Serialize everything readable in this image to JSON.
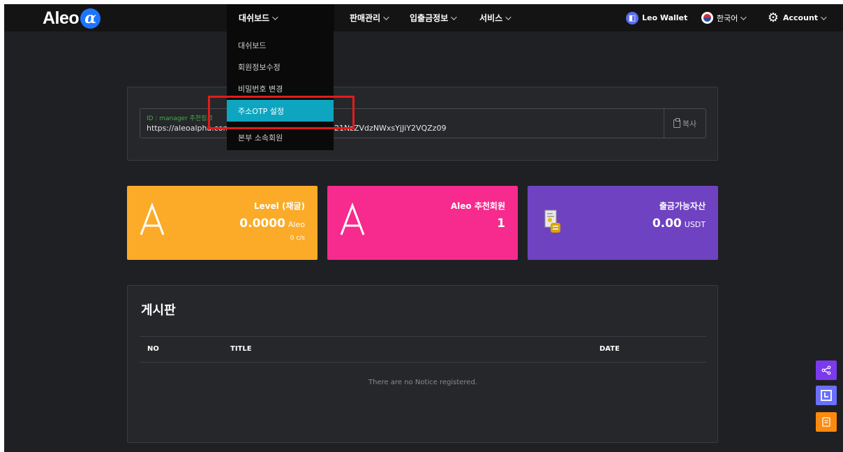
{
  "header": {
    "logo_text": "Aleo",
    "logo_symbol": "α",
    "nav": [
      {
        "label": "대쉬보드",
        "active": true
      },
      {
        "label": "판매관리",
        "active": false
      },
      {
        "label": "입출금정보",
        "active": false
      },
      {
        "label": "서비스",
        "active": false
      }
    ],
    "wallet_label": "Leo Wallet",
    "language_label": "한국어",
    "account_label": "Account"
  },
  "dropdown": {
    "items": [
      {
        "label": "대쉬보드",
        "active": false
      },
      {
        "label": "회원정보수정",
        "active": false
      },
      {
        "label": "비밀번호 변경",
        "active": false
      },
      {
        "label": "주소OTP 설정",
        "active": true
      },
      {
        "label": "본부 소속회원",
        "active": false
      }
    ]
  },
  "referral": {
    "label": "ID : manager 추천링크",
    "url_start": "https://aleoalpha.com",
    "url_end": "21NzZVdzNWxsYjJiY2VQZz09",
    "copy_label": "복사"
  },
  "stats": [
    {
      "title": "Level (채굴)",
      "value": "0.0000",
      "unit": "Aleo",
      "sub": "0 c/s",
      "color": "#fbab28"
    },
    {
      "title": "Aleo 추천회원",
      "value": "1",
      "unit": "",
      "sub": "",
      "color": "#f72a8e"
    },
    {
      "title": "출금가능자산",
      "value": "0.00",
      "unit": "USDT",
      "sub": "",
      "color": "#6f42c1"
    }
  ],
  "board": {
    "title": "게시판",
    "columns": [
      "NO",
      "TITLE",
      "DATE"
    ],
    "empty_message": "There are no Notice registered."
  },
  "icons": {
    "share": "share-icon",
    "brand": "leo-icon",
    "note": "document-icon"
  }
}
